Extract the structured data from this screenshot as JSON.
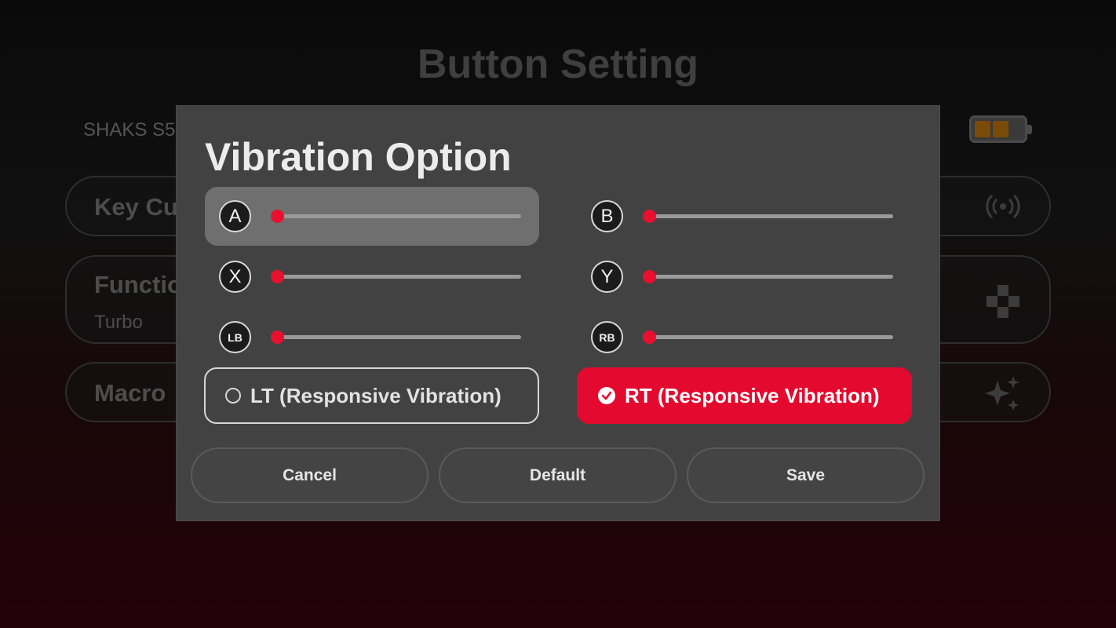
{
  "background": {
    "title": "Button Setting",
    "device_name": "SHAKS S5",
    "items": [
      {
        "label": "Key Cu",
        "icon": "broadcast-icon"
      },
      {
        "label": "Functio",
        "sub": "Turbo",
        "icon": "dpad-icon"
      },
      {
        "label": "Macro",
        "icon": "sparkle-icon"
      }
    ],
    "battery_color": "#7a4a08"
  },
  "dialog": {
    "title": "Vibration Option",
    "sliders": [
      {
        "button": "A",
        "value": 0,
        "selected": true
      },
      {
        "button": "B",
        "value": 0,
        "selected": false
      },
      {
        "button": "X",
        "value": 0,
        "selected": false
      },
      {
        "button": "Y",
        "value": 0,
        "selected": false
      },
      {
        "button": "LB",
        "value": 0,
        "selected": false
      },
      {
        "button": "RB",
        "value": 0,
        "selected": false
      }
    ],
    "options": [
      {
        "label": "LT (Responsive Vibration)",
        "checked": false
      },
      {
        "label": "RT (Responsive Vibration)",
        "checked": true
      }
    ],
    "actions": {
      "cancel": "Cancel",
      "default": "Default",
      "save": "Save"
    }
  },
  "colors": {
    "accent": "#e4092e",
    "dialog_bg": "#424242"
  }
}
